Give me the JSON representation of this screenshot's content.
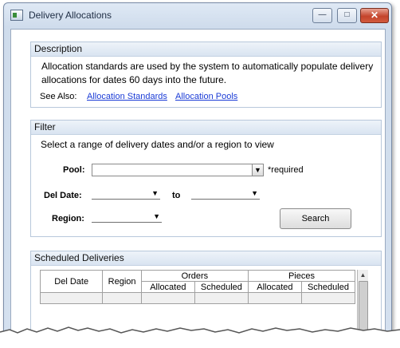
{
  "window": {
    "title": "Delivery Allocations",
    "minimize_glyph": "—",
    "maximize_glyph": "□",
    "close_glyph": "✕"
  },
  "description": {
    "header": "Description",
    "text": "Allocation standards are used by the system to automatically populate delivery allocations for dates 60 days into the future.",
    "see_also_label": "See Also:",
    "links": [
      "Allocation Standards",
      "Allocation Pools"
    ]
  },
  "filter": {
    "header": "Filter",
    "prompt": "Select a range of delivery dates and/or a region to view",
    "pool_label": "Pool:",
    "pool_value": "",
    "required_note": "*required",
    "del_date_label": "Del Date:",
    "from_value": "",
    "to_label": "to",
    "to_value": "",
    "region_label": "Region:",
    "region_value": "",
    "search_button": "Search"
  },
  "scheduled": {
    "header": "Scheduled Deliveries",
    "columns": {
      "del_date": "Del Date",
      "region": "Region",
      "orders": "Orders",
      "pieces": "Pieces",
      "allocated": "Allocated",
      "scheduled": "Scheduled"
    },
    "rows": []
  },
  "icons": [
    "app-icon",
    "minimize-icon",
    "maximize-icon",
    "close-icon",
    "dropdown-arrow-icon",
    "scroll-up-icon"
  ]
}
